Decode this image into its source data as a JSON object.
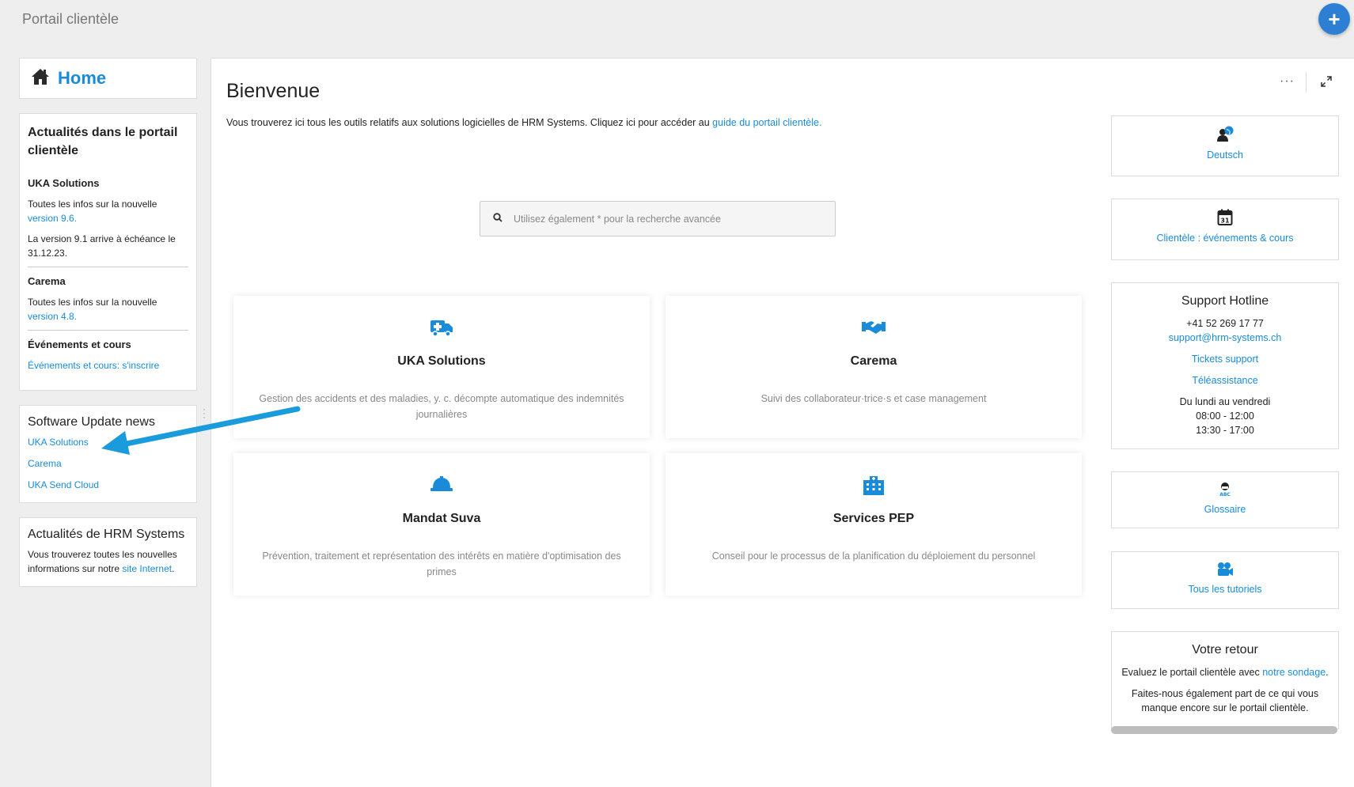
{
  "topbar": {
    "title": "Portail clientèle",
    "add_label": "+"
  },
  "sidebar": {
    "home_label": "Home",
    "news": {
      "title": "Actualités dans le portail clientèle",
      "sections": [
        {
          "title": "UKA Solutions",
          "lines": [
            {
              "text": "Toutes les infos sur la nouvelle ",
              "link": "version 9.6."
            },
            {
              "text": "La version 9.1 arrive à échéance le 31.12.23.",
              "link": ""
            }
          ]
        },
        {
          "title": "Carema",
          "lines": [
            {
              "text": "Toutes les infos sur la nouvelle ",
              "link": "version 4.8."
            }
          ]
        },
        {
          "title": "Événements et cours",
          "lines": [
            {
              "text": "",
              "link": "Événements et cours: s'inscrire"
            }
          ]
        }
      ]
    },
    "updates": {
      "title": "Software Update news",
      "links": [
        "UKA Solutions",
        "Carema",
        "UKA Send Cloud"
      ]
    },
    "hrm": {
      "title": "Actualités de HRM Systems",
      "text": "Vous trouverez toutes les nouvelles informations sur notre ",
      "link": "site Internet",
      "suffix": "."
    }
  },
  "main": {
    "title": "Bienvenue",
    "intro_text": "Vous trouverez ici tous les outils relatifs aux solutions logicielles de HRM Systems. Cliquez ici pour accéder au ",
    "intro_link": "guide du portail clientèle.",
    "more_label": "···",
    "search_placeholder": "Utilisez également * pour la recherche avancée",
    "cards": [
      {
        "icon": "ambulance-icon",
        "title": "UKA Solutions",
        "desc": "Gestion des accidents et des maladies, y. c. décompte automatique des indemnités journalières"
      },
      {
        "icon": "handshake-icon",
        "title": "Carema",
        "desc": "Suivi des collaborateur·trice·s et case management"
      },
      {
        "icon": "hard-hat-icon",
        "title": "Mandat Suva",
        "desc": "Prévention, traitement et représentation des intérêts en matière d'optimisation des primes"
      },
      {
        "icon": "building-icon",
        "title": "Services PEP",
        "desc": "Conseil pour le processus de la planification du déploiement du personnel"
      }
    ]
  },
  "right": {
    "deutsch": "Deutsch",
    "events": "Clientèle : événements & cours",
    "support": {
      "title": "Support Hotline",
      "phone": "+41 52 269 17 77",
      "email": "support@hrm-systems.ch",
      "tickets": "Tickets support",
      "remote": "Téléassistance",
      "days": "Du lundi au vendredi",
      "hours_am": "08:00 - 12:00",
      "hours_pm": "13:30 - 17:00"
    },
    "glossary": "Glossaire",
    "tutorials": "Tous les tutoriels",
    "feedback": {
      "title": "Votre retour",
      "line1_text": "Evaluez le portail clientèle avec ",
      "line1_link": "notre sondage",
      "line1_suffix": ".",
      "line2": "Faites-nous également part de ce qui vous manque encore sur le portail clientèle."
    }
  },
  "colors": {
    "accent": "#1a8bd8",
    "fab": "#2d7fd3",
    "arrow": "#1a9bdc"
  }
}
